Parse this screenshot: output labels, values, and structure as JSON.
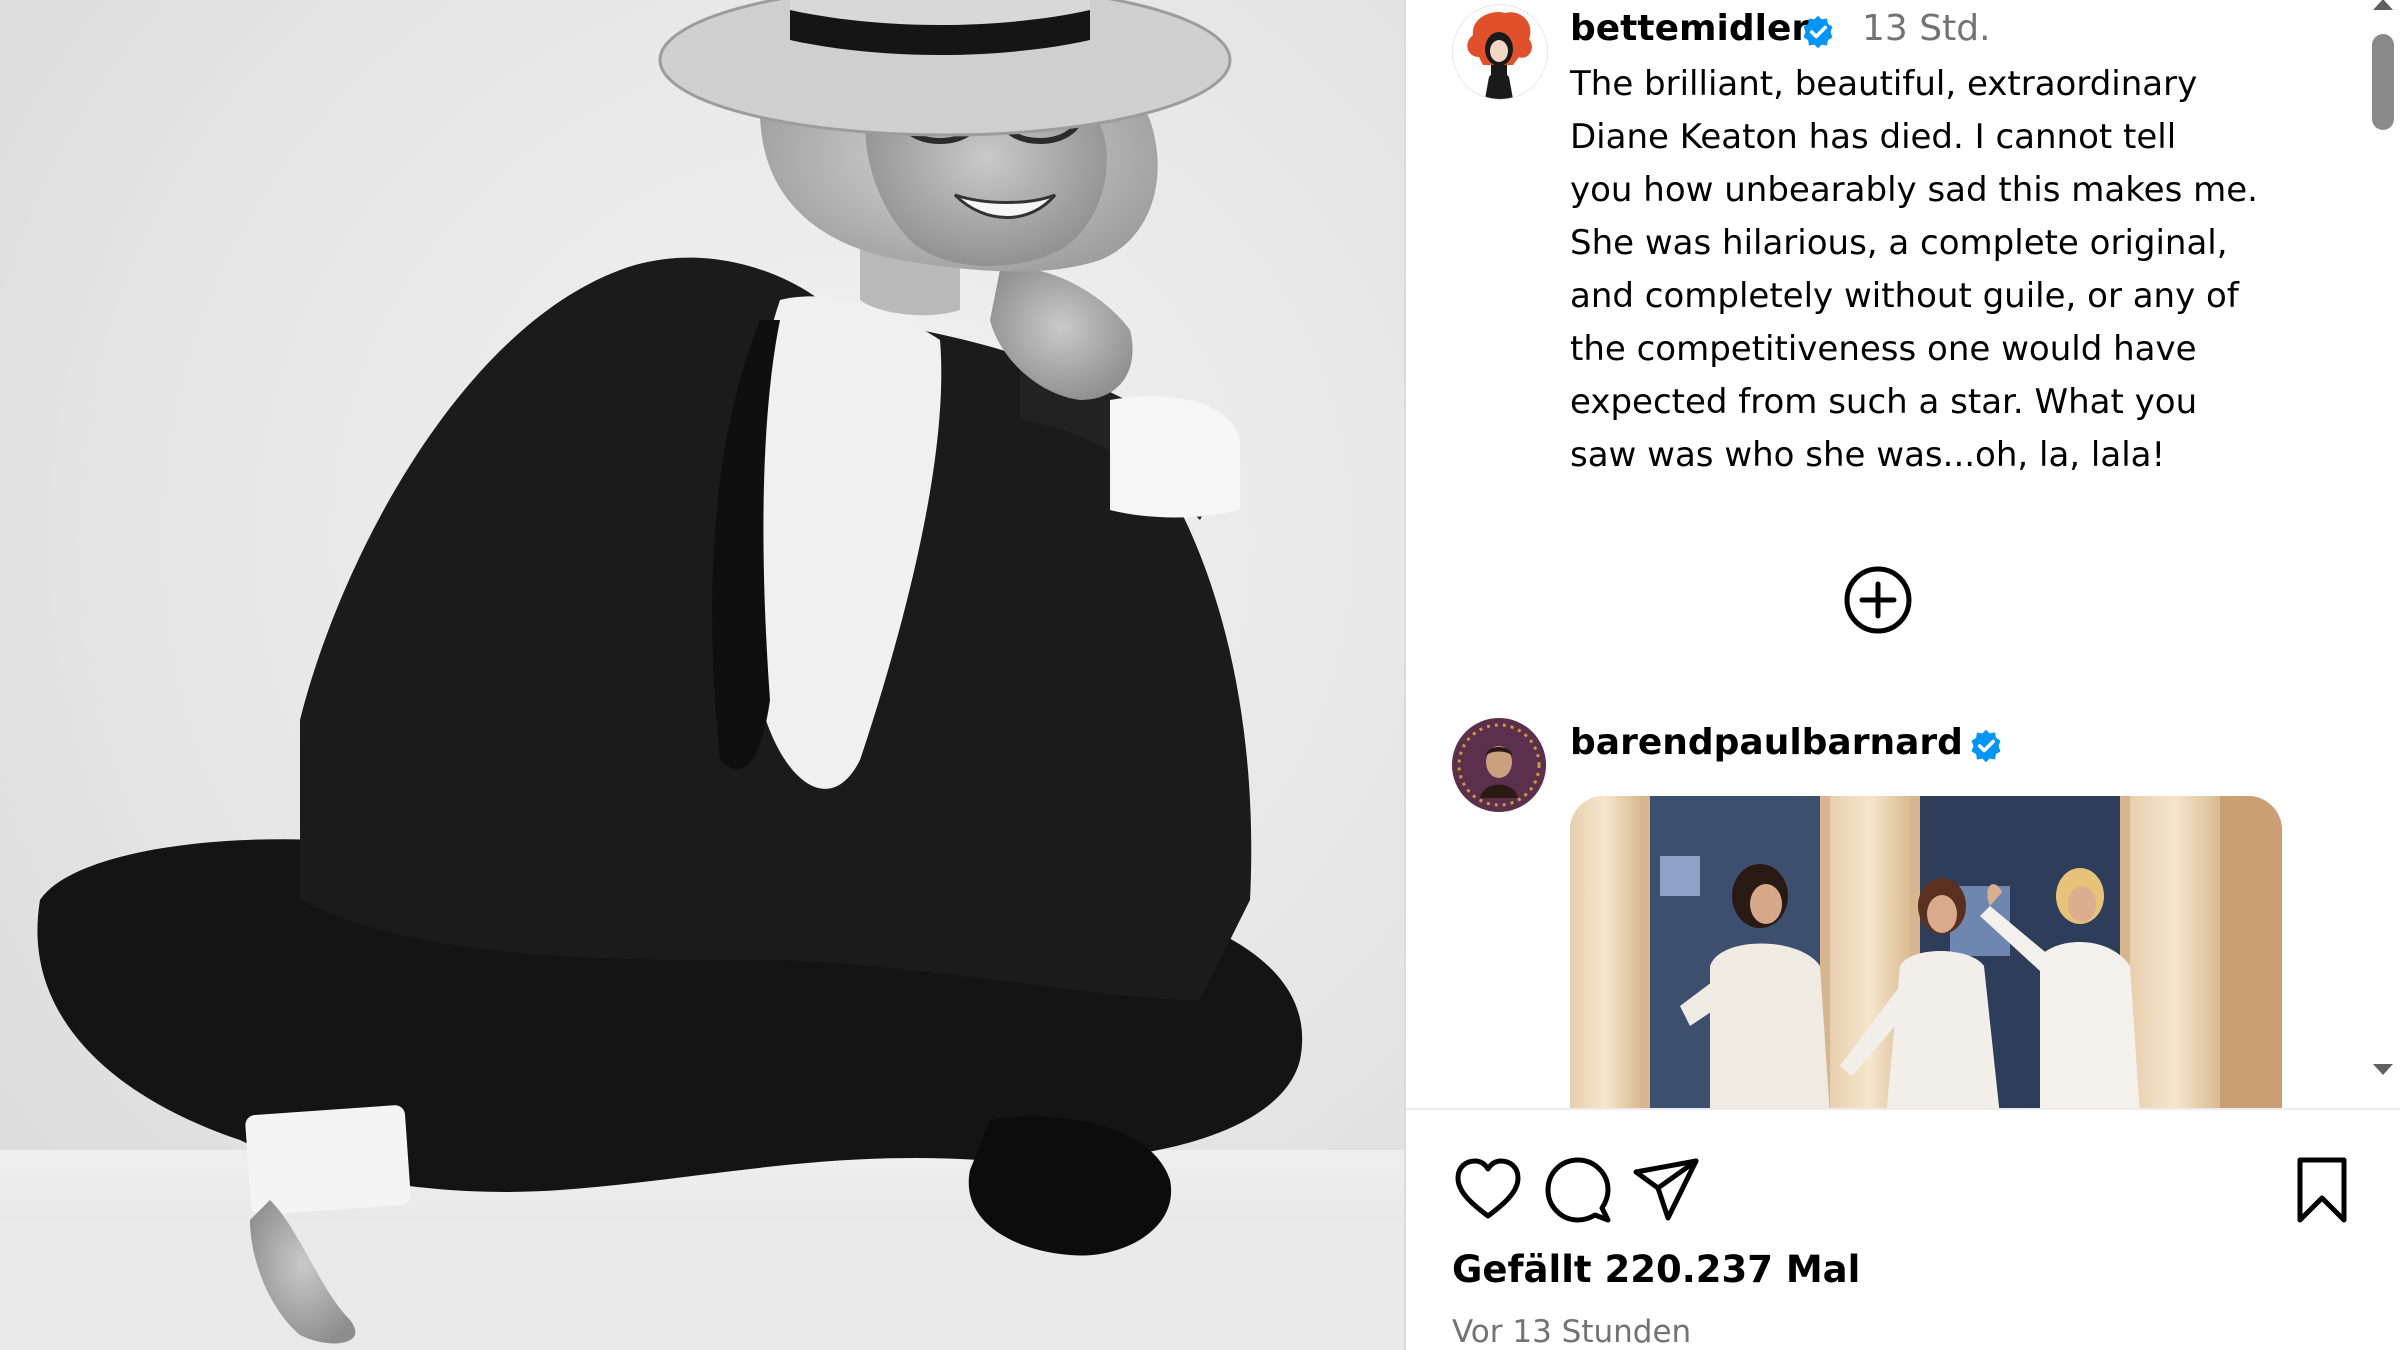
{
  "post": {
    "author": "bettemidler",
    "author_verified": true,
    "timestamp": "13 Std.",
    "caption_lines": [
      "The brilliant, beautiful, extraordinary",
      "Diane Keaton has died.  I cannot tell",
      "you how unbearably sad this makes me.",
      "She was hilarious, a complete original,",
      "and completely without guile, or any of",
      "the competitiveness one would have",
      "expected from such a star.  What you",
      "saw was who she was...oh, la, lala!"
    ],
    "load_more_icon": "plus-circle-icon"
  },
  "comment": {
    "author": "barendpaulbarnard",
    "author_verified": true,
    "media": "gif-image"
  },
  "actions": {
    "like_icon": "heart-outline-icon",
    "comment_icon": "speech-bubble-icon",
    "share_icon": "paper-plane-icon",
    "save_icon": "bookmark-outline-icon",
    "likes_text": "Gefällt 220.237 Mal",
    "time_ago": "Vor 13 Stunden"
  },
  "colors": {
    "verified": "#0095f6",
    "secondary_text": "#737373",
    "divider": "#dbdbdb"
  }
}
